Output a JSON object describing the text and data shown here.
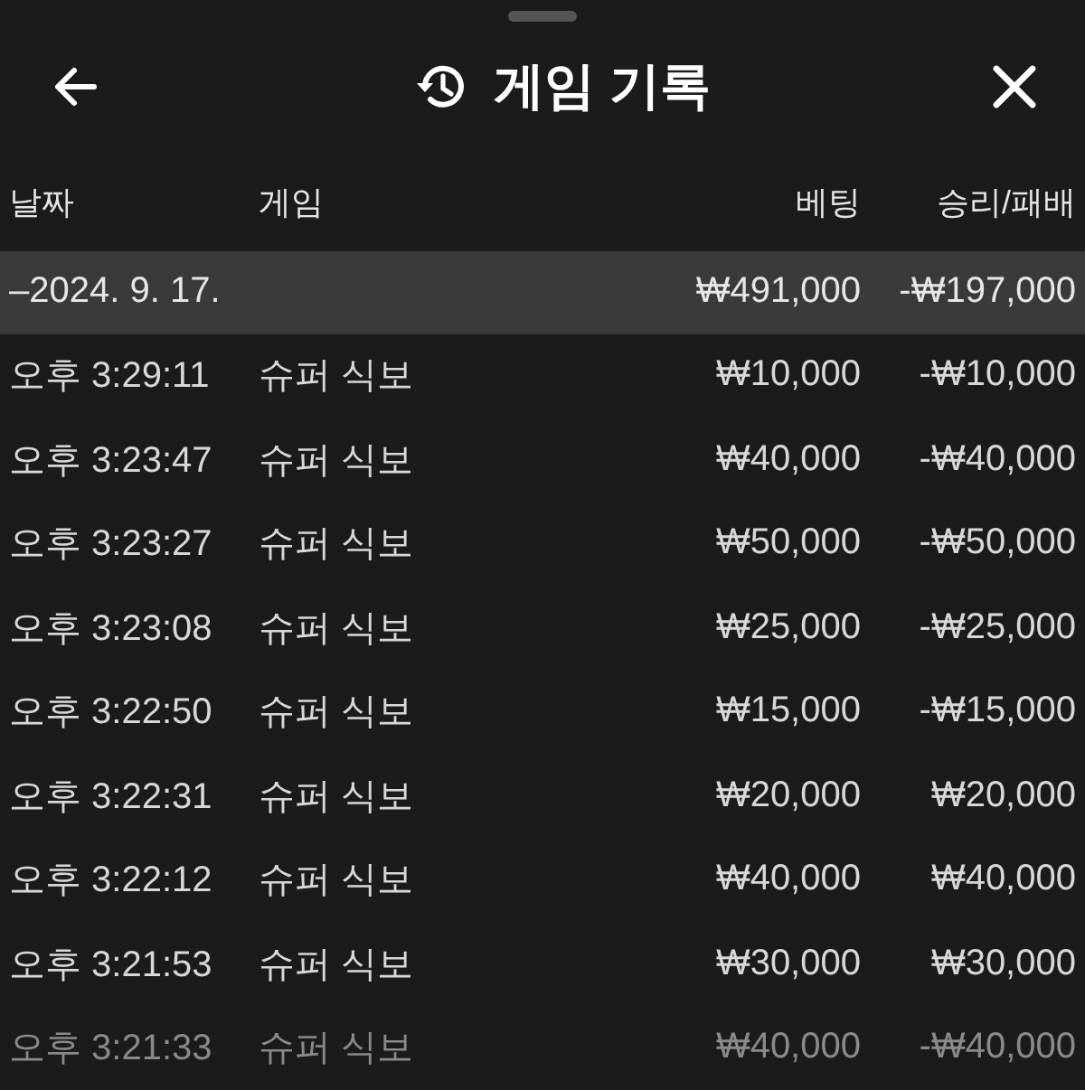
{
  "header": {
    "title": "게임 기록"
  },
  "table": {
    "columns": [
      "날짜",
      "게임",
      "베팅",
      "승리/패배"
    ],
    "group": {
      "date": "–2024. 9. 17.",
      "bet": "₩491,000",
      "result": "-₩197,000"
    },
    "rows": [
      {
        "time": "오후 3:29:11",
        "game": "슈퍼 식보",
        "bet": "₩10,000",
        "result": "-₩10,000"
      },
      {
        "time": "오후 3:23:47",
        "game": "슈퍼 식보",
        "bet": "₩40,000",
        "result": "-₩40,000"
      },
      {
        "time": "오후 3:23:27",
        "game": "슈퍼 식보",
        "bet": "₩50,000",
        "result": "-₩50,000"
      },
      {
        "time": "오후 3:23:08",
        "game": "슈퍼 식보",
        "bet": "₩25,000",
        "result": "-₩25,000"
      },
      {
        "time": "오후 3:22:50",
        "game": "슈퍼 식보",
        "bet": "₩15,000",
        "result": "-₩15,000"
      },
      {
        "time": "오후 3:22:31",
        "game": "슈퍼 식보",
        "bet": "₩20,000",
        "result": "₩20,000"
      },
      {
        "time": "오후 3:22:12",
        "game": "슈퍼 식보",
        "bet": "₩40,000",
        "result": "₩40,000"
      },
      {
        "time": "오후 3:21:53",
        "game": "슈퍼 식보",
        "bet": "₩30,000",
        "result": "₩30,000"
      },
      {
        "time": "오후 3:21:33",
        "game": "슈퍼 식보",
        "bet": "₩40,000",
        "result": "-₩40,000"
      }
    ]
  }
}
